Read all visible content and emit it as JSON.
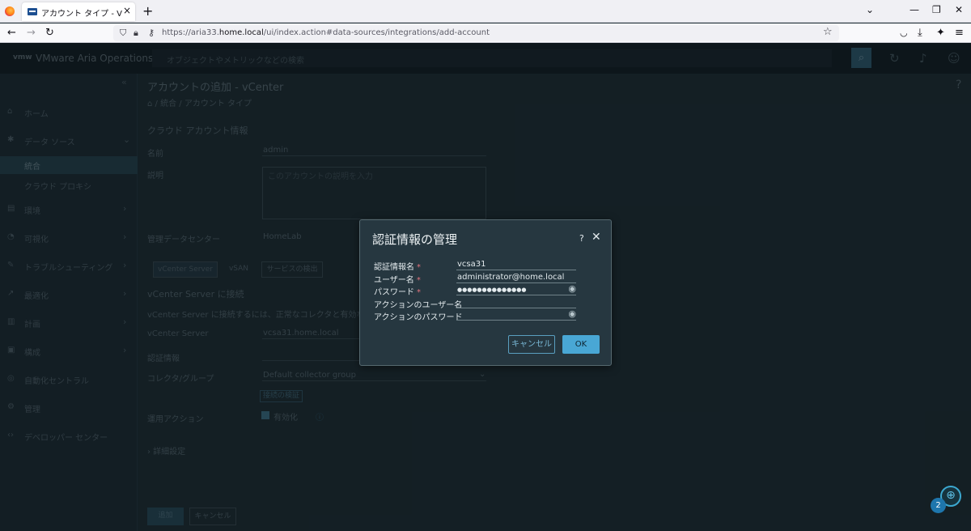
{
  "browser": {
    "tab_title": "アカウント タイプ - VMware Aria O",
    "tab_close": "×",
    "new_tab": "+",
    "url_prefix": "https://aria33.",
    "url_host": "home.local",
    "url_path": "/ui/index.action#data-sources/integrations/add-account",
    "win_minimize": "—",
    "win_restore": "❐",
    "win_close": "✕"
  },
  "app": {
    "logo_text": "vmw",
    "brand": "VMware Aria Operations",
    "search_placeholder": "オブジェクトやメトリックなどの検索"
  },
  "sidebar": {
    "collapse": "«",
    "items": [
      {
        "icon": "⌂",
        "label": "ホーム",
        "chevron": ""
      },
      {
        "icon": "✱",
        "label": "データ ソース",
        "chevron": "⌄"
      },
      {
        "icon": "",
        "label": "統合",
        "chevron": ""
      },
      {
        "icon": "",
        "label": "クラウド プロキシ",
        "chevron": ""
      },
      {
        "icon": "▤",
        "label": "環境",
        "chevron": "›"
      },
      {
        "icon": "◔",
        "label": "可視化",
        "chevron": "›"
      },
      {
        "icon": "✎",
        "label": "トラブルシューティング",
        "chevron": "›"
      },
      {
        "icon": "↗",
        "label": "最適化",
        "chevron": "›"
      },
      {
        "icon": "▥",
        "label": "計画",
        "chevron": "›"
      },
      {
        "icon": "▣",
        "label": "構成",
        "chevron": "›"
      },
      {
        "icon": "◎",
        "label": "自動化セントラル",
        "chevron": ""
      },
      {
        "icon": "⚙",
        "label": "管理",
        "chevron": ""
      },
      {
        "icon": "‹›",
        "label": "デベロッパー センター",
        "chevron": ""
      }
    ]
  },
  "main": {
    "page_title": "アカウントの追加 - vCenter",
    "breadcrumb_home": "⌂",
    "breadcrumb_sep": "/",
    "breadcrumb_1": "統合",
    "breadcrumb_2": "アカウント タイプ",
    "section_cloud": "クラウド アカウント情報",
    "name_label": "名前",
    "name_value": "admin",
    "desc_label": "説明",
    "desc_placeholder": "このアカウントの説明を入力",
    "dc_label": "管理データセンター",
    "dc_value": "HomeLab",
    "tab_vcenter": "vCenter Server",
    "tab_vsan": "vSAN",
    "tab_service": "サービスの検出",
    "connect_heading": "vCenter Server に接続",
    "connect_desc": "vCenter Server に接続するには、正常なコレクタと有効な認証情報",
    "vc_label": "vCenter Server",
    "vc_value": "vcsa31.home.local",
    "cred_label": "認証情報",
    "collector_label": "コレクタ/グループ",
    "collector_value": "Default collector group",
    "validate_btn": "接続の検証",
    "action_label": "運用アクション",
    "action_value": "有効化",
    "advanced": "› 詳細設定",
    "add_btn": "追加",
    "cancel_btn": "キャンセル"
  },
  "dialog": {
    "title": "認証情報の管理",
    "help": "?",
    "close": "✕",
    "fields": [
      {
        "label": "認証情報名",
        "required": "*",
        "value": "vcsa31"
      },
      {
        "label": "ユーザー名",
        "required": "*",
        "value": "administrator@home.local"
      },
      {
        "label": "パスワード",
        "required": "*",
        "value": "●●●●●●●●●●●●●●"
      },
      {
        "label": "アクションのユーザー名",
        "required": "",
        "value": ""
      },
      {
        "label": "アクションのパスワード",
        "required": "",
        "value": ""
      }
    ],
    "eye": "◉",
    "cancel": "キャンセル",
    "ok": "OK"
  },
  "floating": {
    "icon": "⊕",
    "badge": "2"
  }
}
